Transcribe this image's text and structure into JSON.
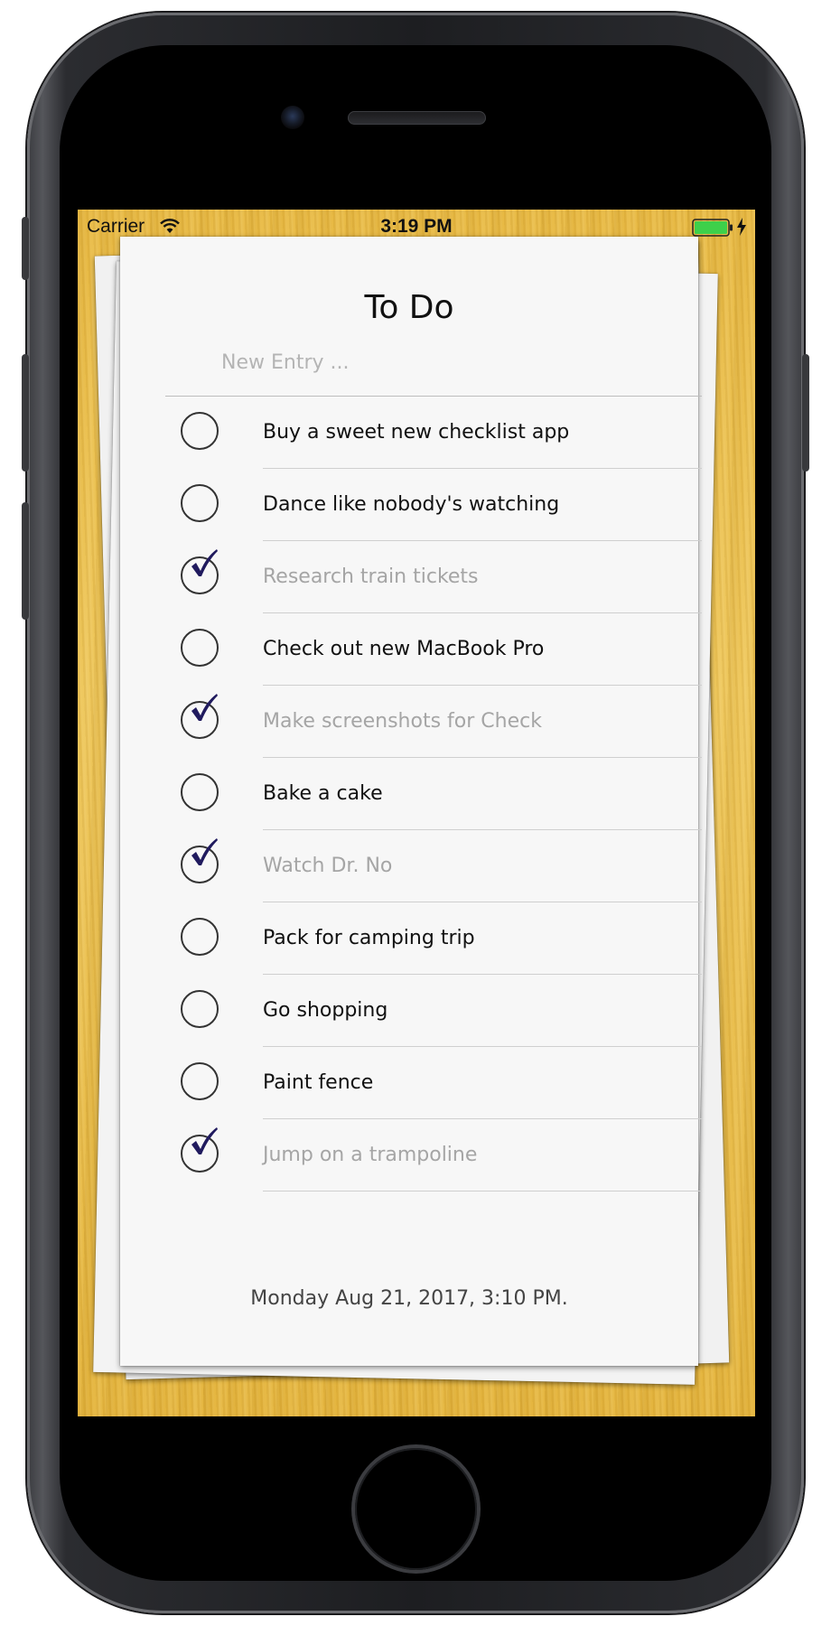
{
  "status_bar": {
    "carrier": "Carrier",
    "time": "3:19 PM",
    "wifi_icon": "wifi-icon",
    "battery_icon": "battery-icon",
    "battery_color": "#3ed04a",
    "charging_icon": "charging-bolt-icon"
  },
  "app": {
    "title": "To Do",
    "new_entry_placeholder": "New Entry ...",
    "check_color": "#201a5e",
    "items": [
      {
        "label": "Buy a sweet new checklist app",
        "done": false
      },
      {
        "label": "Dance like nobody's watching",
        "done": false
      },
      {
        "label": "Research train tickets",
        "done": true
      },
      {
        "label": "Check out new MacBook Pro",
        "done": false
      },
      {
        "label": "Make screenshots for Check",
        "done": true
      },
      {
        "label": "Bake a cake",
        "done": false
      },
      {
        "label": "Watch Dr. No",
        "done": true
      },
      {
        "label": "Pack for camping trip",
        "done": false
      },
      {
        "label": "Go shopping",
        "done": false
      },
      {
        "label": "Paint fence",
        "done": false
      },
      {
        "label": "Jump on a trampoline",
        "done": true
      }
    ],
    "footer_date": "Monday Aug 21, 2017, 3:10 PM."
  }
}
